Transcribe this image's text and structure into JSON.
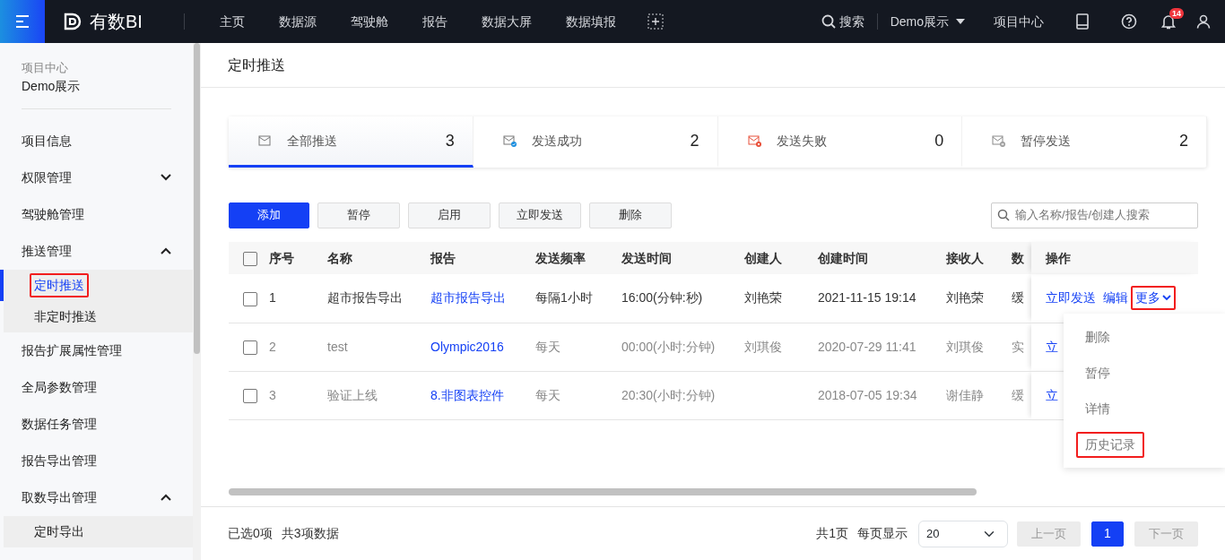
{
  "topbar": {
    "brand": "有数BI",
    "nav": [
      {
        "label": "主页"
      },
      {
        "label": "数据源"
      },
      {
        "label": "驾驶舱"
      },
      {
        "label": "报告"
      },
      {
        "label": "数据大屏"
      },
      {
        "label": "数据填报"
      }
    ],
    "search": "搜索",
    "project": "Demo展示",
    "project_center": "项目中心",
    "notifications": "14"
  },
  "sidebar": {
    "caption": "项目中心",
    "project": "Demo展示",
    "items": [
      {
        "label": "项目信息"
      },
      {
        "label": "权限管理",
        "expanded": false
      },
      {
        "label": "驾驶舱管理"
      },
      {
        "label": "推送管理",
        "expanded": true,
        "children": [
          {
            "label": "定时推送",
            "selected": true,
            "highlighted": true
          },
          {
            "label": "非定时推送",
            "selected": false,
            "highlighted": false
          }
        ]
      },
      {
        "label": "报告扩展属性管理"
      },
      {
        "label": "全局参数管理"
      },
      {
        "label": "数据任务管理"
      },
      {
        "label": "报告导出管理"
      },
      {
        "label": "取数导出管理",
        "expanded": true,
        "children": [
          {
            "label": "定时导出",
            "selected": false,
            "highlighted": false
          }
        ]
      }
    ]
  },
  "page_title": "定时推送",
  "stat_tabs": [
    {
      "kind": "all",
      "label": "全部推送",
      "count": "3",
      "selected": true
    },
    {
      "kind": "success",
      "label": "发送成功",
      "count": "2",
      "selected": false
    },
    {
      "kind": "fail",
      "label": "发送失败",
      "count": "0",
      "selected": false
    },
    {
      "kind": "paused",
      "label": "暂停发送",
      "count": "2",
      "selected": false
    }
  ],
  "toolbar": {
    "buttons": [
      {
        "label": "添加",
        "kind": "primary"
      },
      {
        "label": "暂停",
        "kind": "default"
      },
      {
        "label": "启用",
        "kind": "default"
      },
      {
        "label": "立即发送",
        "kind": "default"
      },
      {
        "label": "删除",
        "kind": "default"
      }
    ],
    "search": {
      "placeholder": "输入名称/报告/创建人搜索"
    }
  },
  "table": {
    "all_checked": false,
    "columns": [
      "序号",
      "名称",
      "报告",
      "发送频率",
      "发送时间",
      "创建人",
      "创建时间",
      "接收人",
      "数",
      "操作"
    ],
    "rows": [
      {
        "checked": false,
        "disabled": false,
        "cells": [
          "1",
          "超市报告导出",
          "超市报告导出",
          "每隔1小时",
          "16:00(分钟:秒)",
          "刘艳荣",
          "2021-11-15 19:14",
          "刘艳荣",
          "缓"
        ],
        "actions": [
          {
            "label": "立即发送",
            "kind": "link"
          },
          {
            "label": "编辑",
            "kind": "link"
          },
          {
            "label": "更多",
            "kind": "more",
            "highlighted": true
          }
        ]
      },
      {
        "checked": false,
        "disabled": true,
        "cells": [
          "2",
          "test",
          "Olympic2016",
          "每天",
          "00:00(小时:分钟)",
          "刘琪俊",
          "2020-07-29 11:41",
          "刘琪俊",
          "实"
        ],
        "actions": [
          {
            "label": "立",
            "kind": "link"
          }
        ]
      },
      {
        "checked": false,
        "disabled": true,
        "cells": [
          "3",
          "验证上线",
          "8.非图表控件",
          "每天",
          "20:30(小时:分钟)",
          "",
          "2018-07-05 19:34",
          "谢佳静",
          "缓"
        ],
        "actions": [
          {
            "label": "立",
            "kind": "link"
          }
        ]
      }
    ]
  },
  "more_menu": [
    {
      "label": "删除",
      "highlighted": false
    },
    {
      "label": "暂停",
      "highlighted": false
    },
    {
      "label": "详情",
      "highlighted": false
    },
    {
      "label": "历史记录",
      "highlighted": true
    }
  ],
  "footer": {
    "selected": "已选0项",
    "total": "共3项数据",
    "pages": "共1页",
    "per_page_label": "每页显示",
    "per_page": "20",
    "prev": {
      "label": "上一页",
      "disabled": true
    },
    "page_buttons": [
      {
        "label": "1",
        "selected": true
      }
    ],
    "next": {
      "label": "下一页",
      "disabled": true
    }
  }
}
